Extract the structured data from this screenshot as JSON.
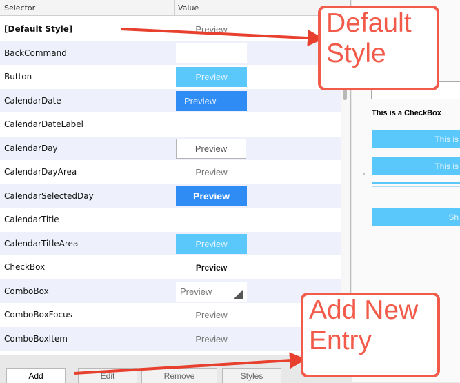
{
  "table": {
    "header": {
      "selector": "Selector",
      "value": "Value"
    },
    "rows": [
      {
        "selector": "[Default Style]",
        "bold": true,
        "preview": "Preview",
        "style": "plain"
      },
      {
        "selector": "BackCommand",
        "preview": "",
        "style": "empty"
      },
      {
        "selector": "Button",
        "preview": "Preview",
        "style": "lightblue"
      },
      {
        "selector": "CalendarDate",
        "preview": "Preview",
        "style": "blue"
      },
      {
        "selector": "CalendarDateLabel",
        "preview": "",
        "style": "none"
      },
      {
        "selector": "CalendarDay",
        "preview": "Preview",
        "style": "boxed"
      },
      {
        "selector": "CalendarDayArea",
        "preview": "Preview",
        "style": "plain"
      },
      {
        "selector": "CalendarSelectedDay",
        "preview": "Preview",
        "style": "strongblue"
      },
      {
        "selector": "CalendarTitle",
        "preview": "",
        "style": "none"
      },
      {
        "selector": "CalendarTitleArea",
        "preview": "Preview",
        "style": "lightblue"
      },
      {
        "selector": "CheckBox",
        "preview": "Preview",
        "style": "bold"
      },
      {
        "selector": "ComboBox",
        "preview": "Preview",
        "style": "combo"
      },
      {
        "selector": "ComboBoxFocus",
        "preview": "Preview",
        "style": "plain"
      },
      {
        "selector": "ComboBoxItem",
        "preview": "Preview",
        "style": "plain"
      }
    ]
  },
  "right_pane": {
    "checkbox_label": "This is a CheckBox",
    "buttons": [
      "This is",
      "This is",
      "Sh"
    ]
  },
  "bottom_tabs": {
    "add": "Add",
    "edit": "Edit",
    "remove": "Remove",
    "styles": "Styles"
  },
  "callouts": {
    "default_style": [
      "Default",
      "Style"
    ],
    "add_new": [
      "Add New",
      "Entry"
    ]
  },
  "colors": {
    "callout": "#f25a4a",
    "light_blue": "#5ac8fa",
    "blue": "#2f8cf5"
  }
}
